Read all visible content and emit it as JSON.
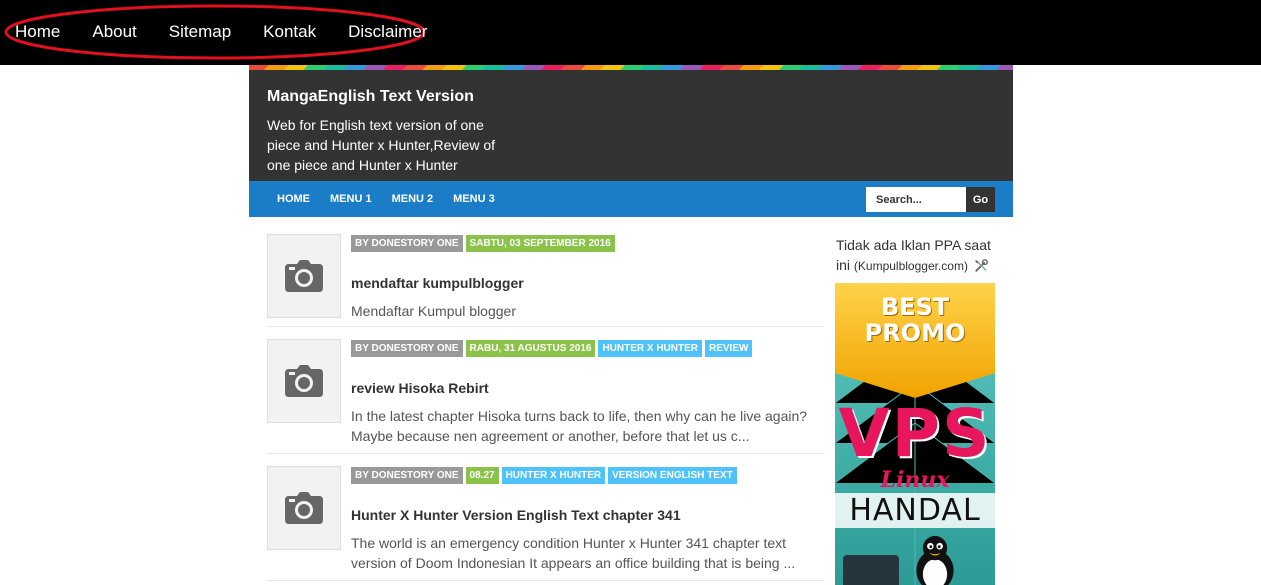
{
  "topnav": {
    "items": [
      "Home",
      "About",
      "Sitemap",
      "Kontak",
      "Disclaimer"
    ],
    "highlight_color": "#e0101e"
  },
  "header": {
    "title": "MangaEnglish Text Version",
    "description": "Web for English text version of one piece and Hunter x Hunter,Review of one piece and Hunter x Hunter"
  },
  "mainnav": {
    "items": [
      "HOME",
      "MENU 1",
      "MENU 2",
      "MENU 3"
    ],
    "search_placeholder": "Search...",
    "search_button": "Go",
    "color": "#1b7cc8"
  },
  "posts": [
    {
      "author": "BY DONESTORY ONE",
      "date": "SABTU, 03 SEPTEMBER 2016",
      "labels": [],
      "title": "mendaftar kumpulblogger",
      "excerpt": "Mendaftar Kumpul blogger",
      "thumb_icon": "camera-icon"
    },
    {
      "author": "BY DONESTORY ONE",
      "date": "RABU, 31 AGUSTUS 2016",
      "labels": [
        "HUNTER X HUNTER",
        "REVIEW"
      ],
      "title": "review Hisoka Rebirt",
      "excerpt": "In the latest chapter Hisoka turns back to life, then why can he live again? Maybe because nen agreement or another, before that let us c...",
      "thumb_icon": "camera-icon"
    },
    {
      "author": "BY DONESTORY ONE",
      "date": "08.27",
      "labels": [
        "HUNTER X HUNTER",
        "VERSION ENGLISH TEXT"
      ],
      "title": "Hunter X Hunter Version English Text chapter 341",
      "excerpt": "The world is an emergency condition Hunter x Hunter 341 chapter text version of Doom Indonesian It appears an office building that is being ...",
      "thumb_icon": "camera-icon"
    }
  ],
  "sidebar": {
    "notice": "Tidak ada Iklan PPA saat ini",
    "notice_source": "(Kumpulblogger.com)",
    "tool_icon": "tools-icon",
    "ad": {
      "badge_line1": "BEST",
      "badge_line2": "PROMO",
      "headline": "VPS",
      "subline": "Linux",
      "tagline": "HANDAL",
      "mascot_icon": "tux-penguin-icon"
    }
  }
}
